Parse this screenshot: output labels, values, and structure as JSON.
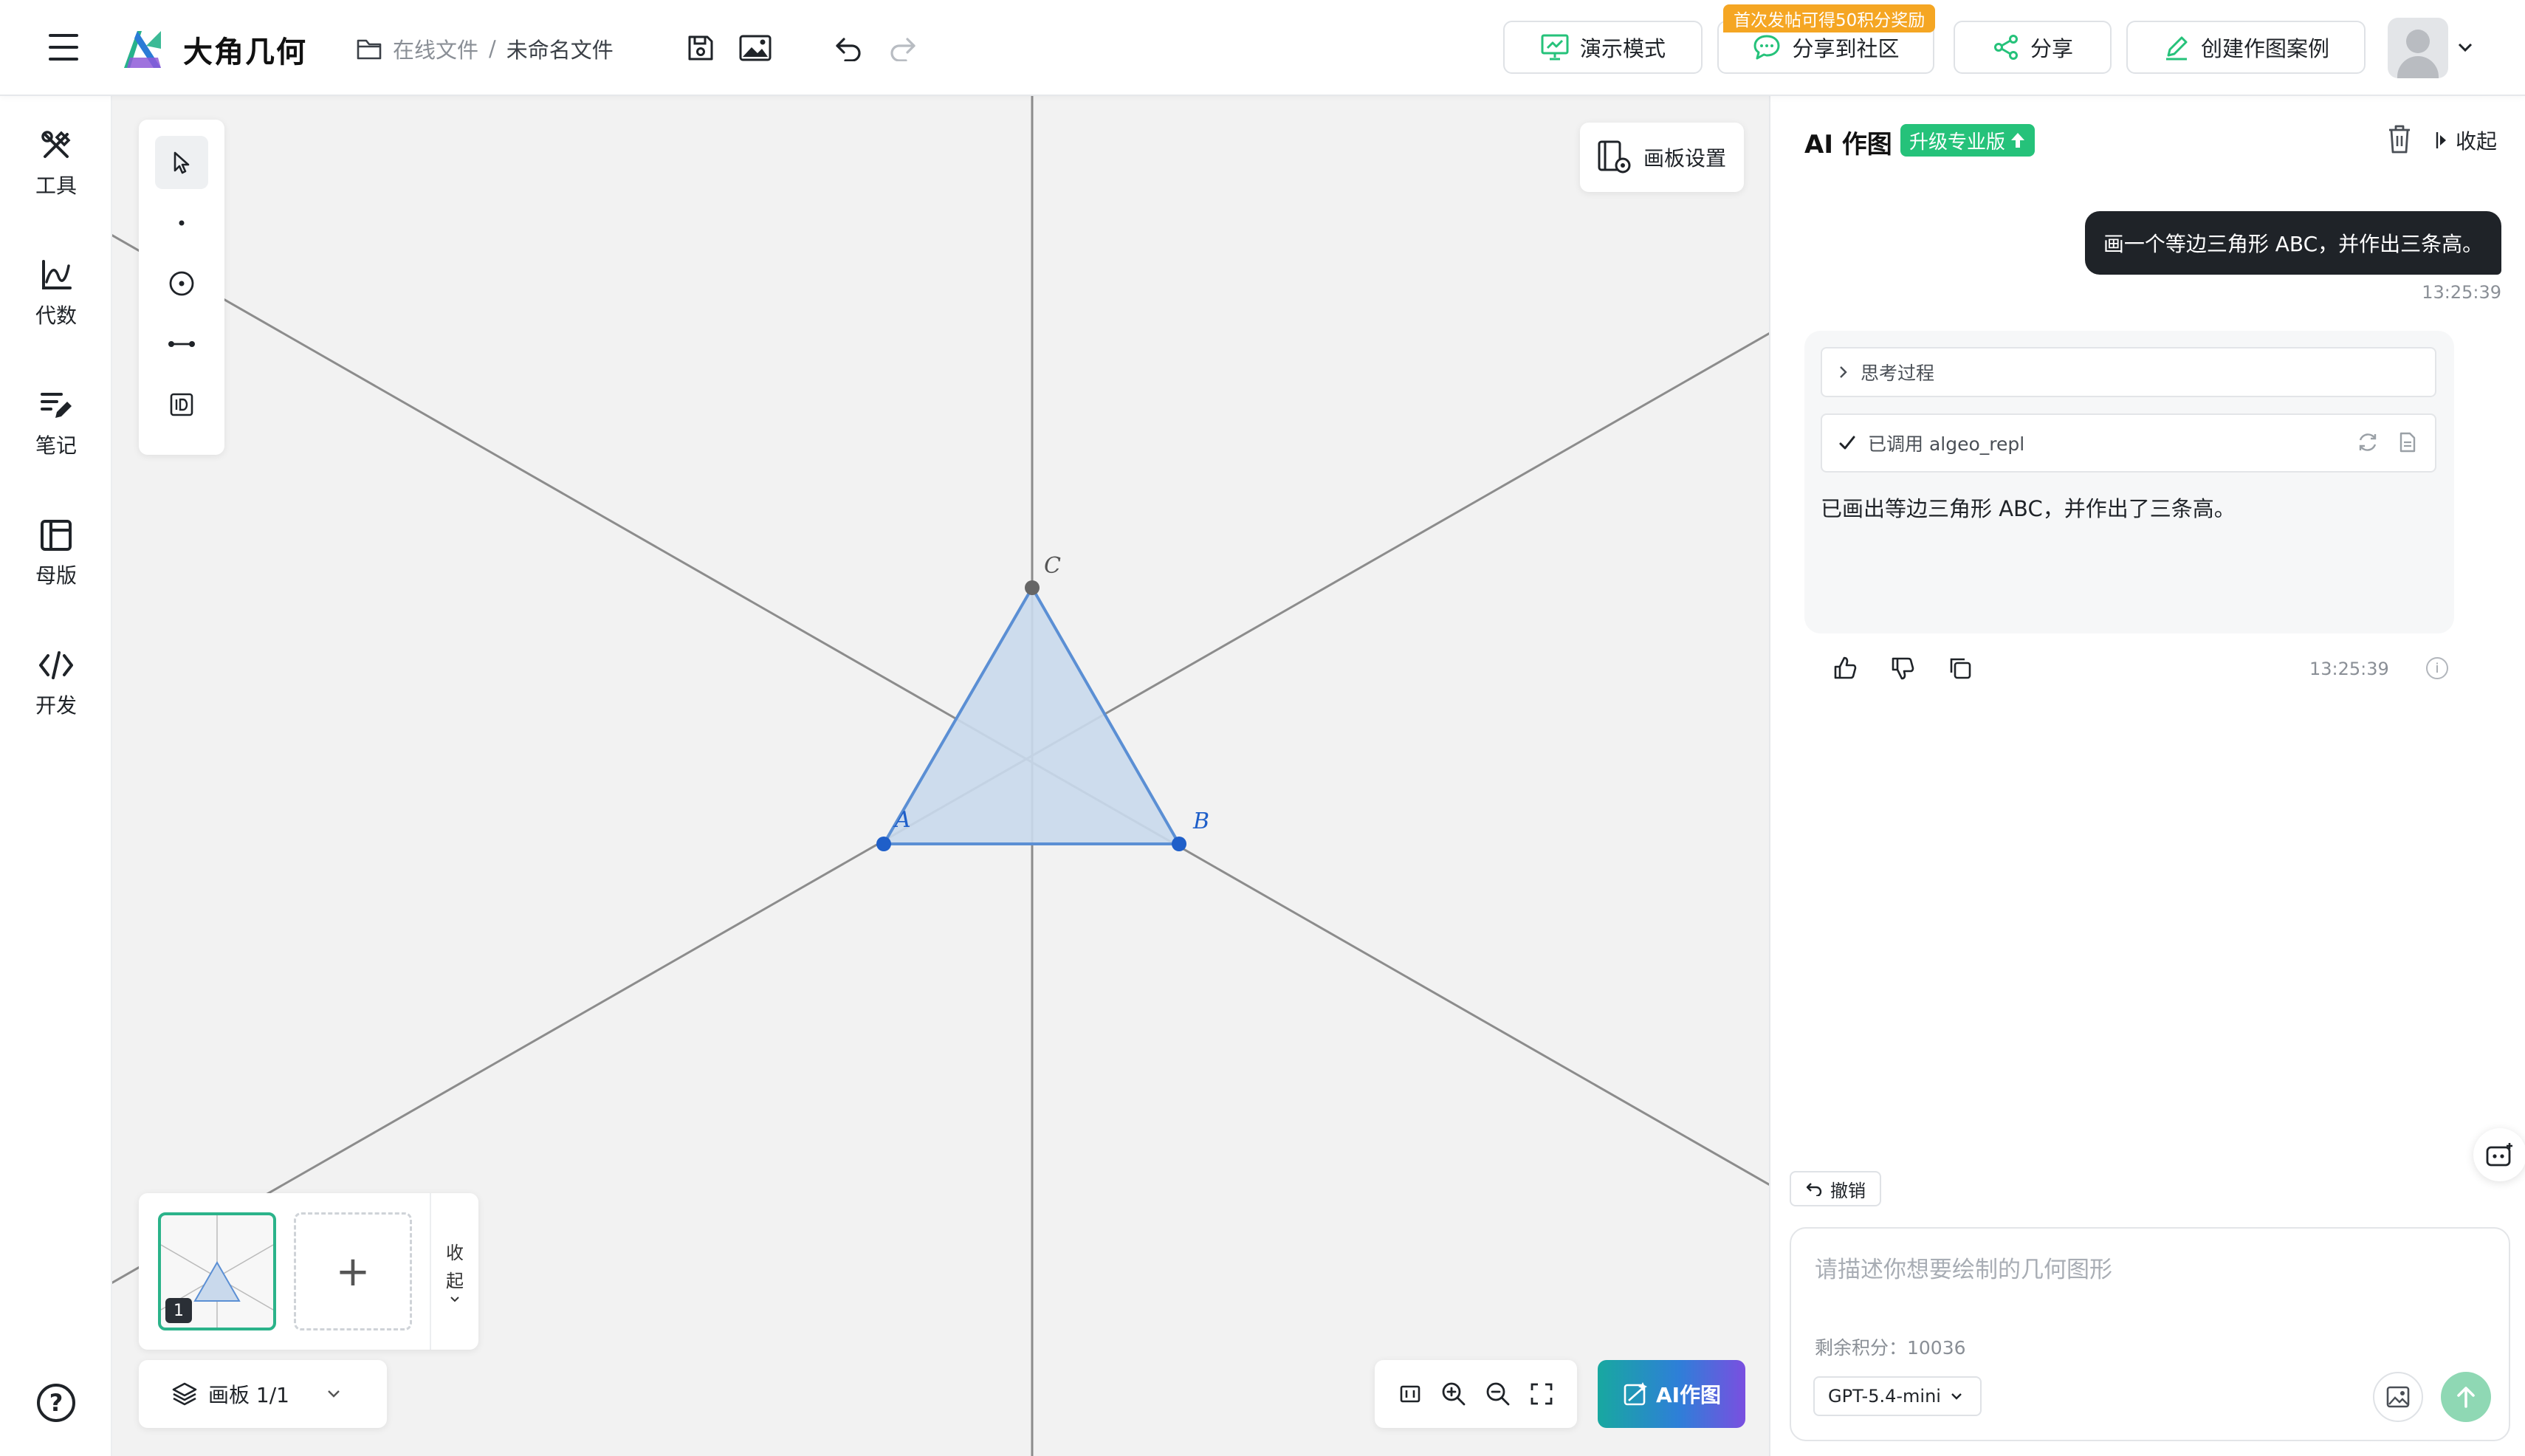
{
  "header": {
    "brand": "大角几何",
    "breadcrumb_root": "在线文件",
    "breadcrumb_sep": "/",
    "file_name": "未命名文件",
    "present_label": "演示模式",
    "community_label": "分享到社区",
    "promo_badge": "首次发帖可得50积分奖励",
    "share_label": "分享",
    "create_case_label": "创建作图案例"
  },
  "sidebar": {
    "items": [
      {
        "label": "工具",
        "icon": "tools-icon"
      },
      {
        "label": "代数",
        "icon": "chart-icon"
      },
      {
        "label": "笔记",
        "icon": "notes-icon"
      },
      {
        "label": "母版",
        "icon": "layout-icon"
      },
      {
        "label": "开发",
        "icon": "code-icon"
      }
    ],
    "help": "?"
  },
  "canvas": {
    "board_settings_label": "画板设置",
    "point_labels": {
      "a": "A",
      "b": "B",
      "c": "C"
    },
    "page_number": "1",
    "add_page": "+",
    "collapse_label_1": "收",
    "collapse_label_2": "起",
    "layer_label": "画板 1/1",
    "ai_button_label": "AI作图",
    "colors": {
      "triangle_fill": "#c9d9ec",
      "triangle_stroke": "#5b8fd4",
      "point_blue": "#1f5fc9",
      "point_gray": "#666666",
      "line": "#8c8c8c"
    }
  },
  "panel": {
    "title": "AI 作图",
    "upgrade_label": "升级专业版",
    "collapse_label": "收起",
    "user_message": "画一个等边三角形 ABC，并作出三条高。",
    "user_time": "13:25:39",
    "thinking_label": "思考过程",
    "tool_call_label": "已调用 algeo_repl",
    "reply": "已画出等边三角形 ABC，并作出了三条高。",
    "reply_time": "13:25:39",
    "undo_label": "撤销",
    "input_placeholder": "请描述你想要绘制的几何图形",
    "credits": "剩余积分：10036",
    "model": "GPT-5.4-mini",
    "accent": "#25c27a"
  }
}
